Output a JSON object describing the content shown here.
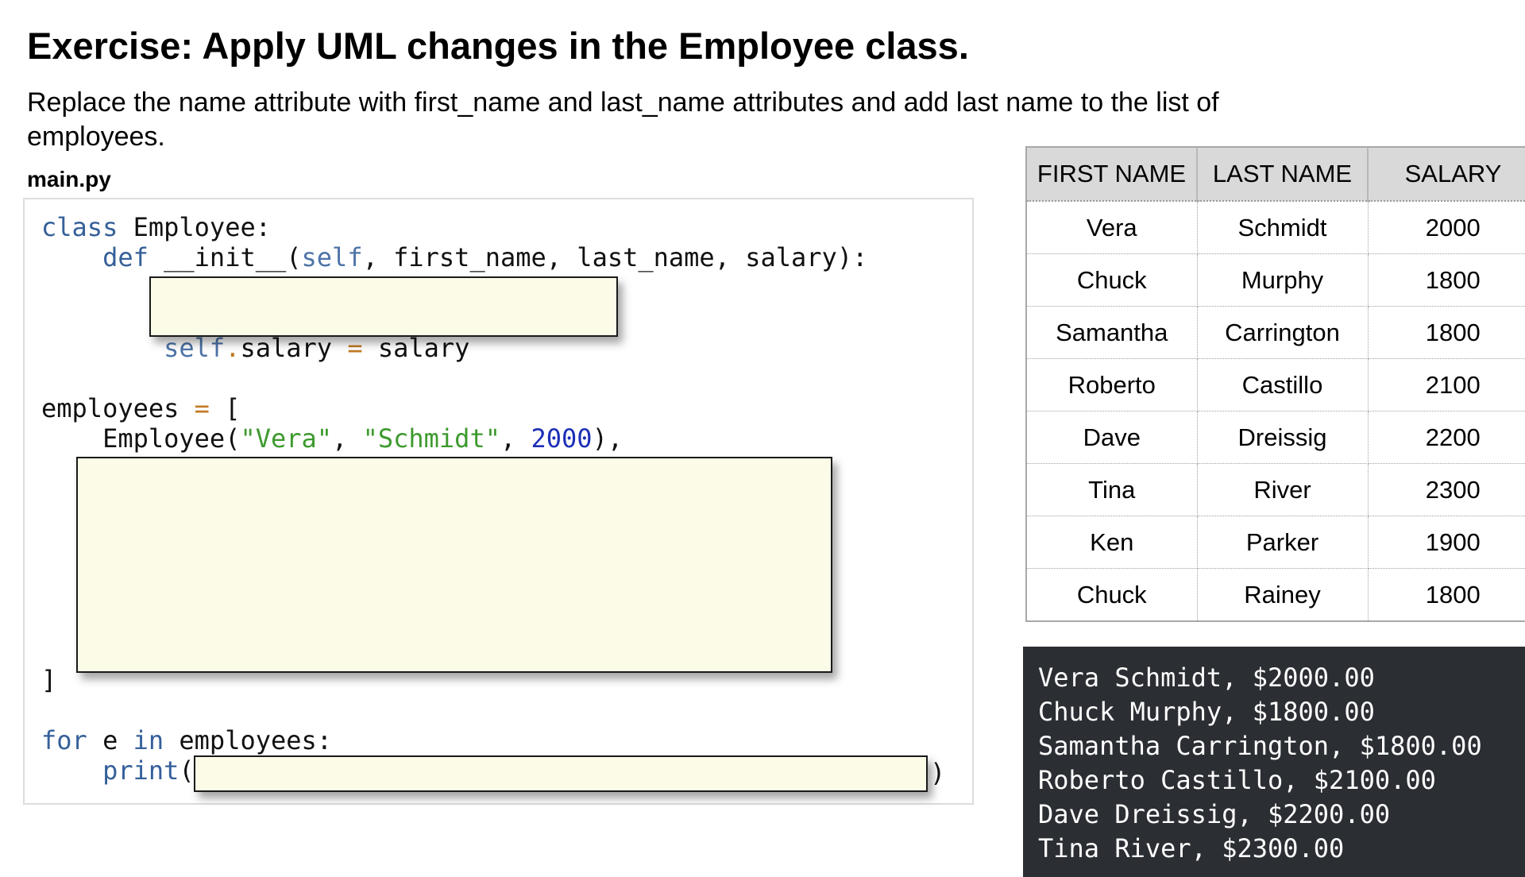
{
  "exercise": {
    "title": "Exercise: Apply UML changes in the Employee class.",
    "instructions": "Replace the name attribute with first_name and last_name attributes and add last name to the list of employees.",
    "filename": "main.py"
  },
  "code": {
    "lines": [
      [
        {
          "t": "class",
          "c": "kw"
        },
        {
          "t": " Employee:"
        }
      ],
      [
        {
          "t": "    "
        },
        {
          "t": "def",
          "c": "kw"
        },
        {
          "t": " __init__("
        },
        {
          "t": "self",
          "c": "self"
        },
        {
          "t": ", first_name, last_name, salary):"
        }
      ],
      [],
      [],
      [
        {
          "t": "        "
        },
        {
          "t": "self",
          "c": "self"
        },
        {
          "t": ".",
          "c": "op"
        },
        {
          "t": "salary "
        },
        {
          "t": "=",
          "c": "op"
        },
        {
          "t": " salary"
        }
      ],
      [],
      [
        {
          "t": "employees "
        },
        {
          "t": "=",
          "c": "op"
        },
        {
          "t": " ["
        }
      ],
      [
        {
          "t": "    Employee("
        },
        {
          "t": "\"Vera\"",
          "c": "str"
        },
        {
          "t": ", "
        },
        {
          "t": "\"Schmidt\"",
          "c": "str"
        },
        {
          "t": ", "
        },
        {
          "t": "2000",
          "c": "num"
        },
        {
          "t": "),"
        }
      ],
      [],
      [],
      [],
      [],
      [],
      [],
      [],
      [
        {
          "t": "]"
        }
      ],
      [],
      [
        {
          "t": "for",
          "c": "kw"
        },
        {
          "t": " e "
        },
        {
          "t": "in",
          "c": "kw"
        },
        {
          "t": " employees:"
        }
      ],
      [
        {
          "t": "    "
        },
        {
          "t": "print",
          "c": "kw"
        },
        {
          "t": "("
        }
      ]
    ],
    "close_paren": ")"
  },
  "table": {
    "headers": [
      "FIRST NAME",
      "LAST NAME",
      "SALARY"
    ],
    "rows": [
      [
        "Vera",
        "Schmidt",
        "2000"
      ],
      [
        "Chuck",
        "Murphy",
        "1800"
      ],
      [
        "Samantha",
        "Carrington",
        "1800"
      ],
      [
        "Roberto",
        "Castillo",
        "2100"
      ],
      [
        "Dave",
        "Dreissig",
        "2200"
      ],
      [
        "Tina",
        "River",
        "2300"
      ],
      [
        "Ken",
        "Parker",
        "1900"
      ],
      [
        "Chuck",
        "Rainey",
        "1800"
      ]
    ]
  },
  "console": {
    "lines": [
      "Vera Schmidt, $2000.00",
      "Chuck Murphy, $1800.00",
      "Samantha Carrington, $1800.00",
      "Roberto Castillo, $2100.00",
      "Dave Dreissig, $2200.00",
      "Tina River, $2300.00"
    ]
  },
  "colors": {
    "keyword": "#35609a",
    "string": "#3d9a2e",
    "number": "#1c2fb7",
    "operator": "#c27a25",
    "blank_fill": "#fbfbe8",
    "console_bg": "#2b2e33",
    "table_header_bg": "#d9d9d9"
  }
}
